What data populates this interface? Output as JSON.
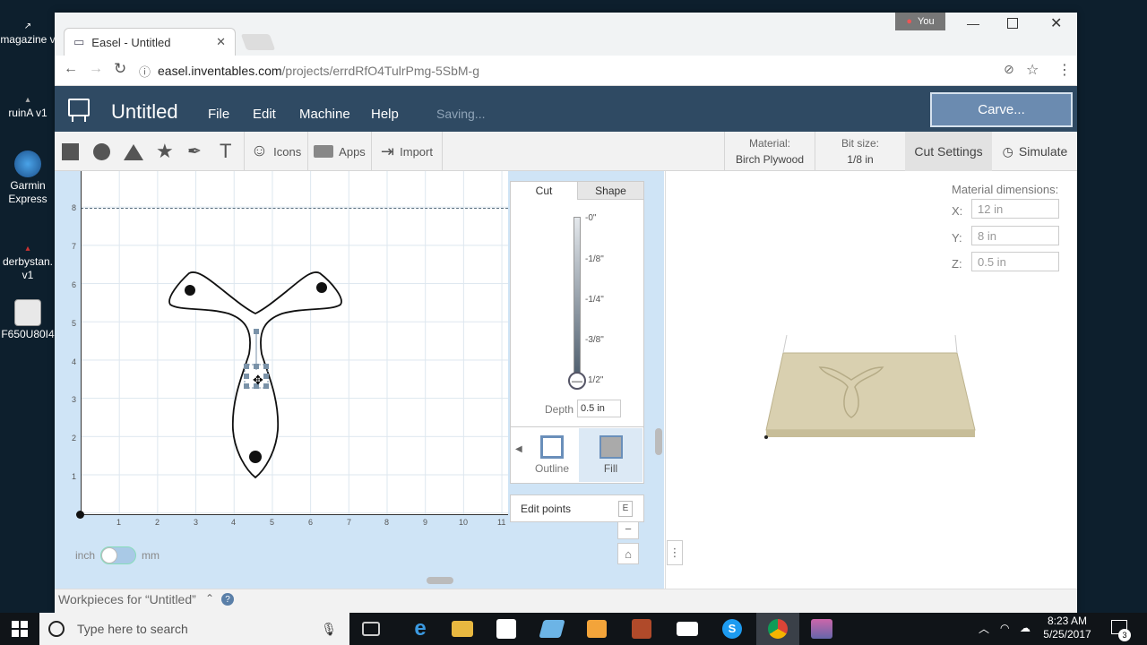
{
  "desktop": {
    "icons": [
      {
        "label": "magazine v"
      },
      {
        "label": "ruinA v1"
      },
      {
        "label": "Garmin Express"
      },
      {
        "label": "derbystan. v1"
      },
      {
        "label": "F650U80I4"
      }
    ],
    "user_badge": "You"
  },
  "browser": {
    "tab_title": "Easel - Untitled",
    "url_domain": "easel.inventables.com",
    "url_path": "/projects/errdRfO4TulrPmg-5SbM-g"
  },
  "app": {
    "title": "Untitled",
    "menus": [
      "File",
      "Edit",
      "Machine",
      "Help"
    ],
    "status": "Saving...",
    "carve_label": "Carve..."
  },
  "toolbar": {
    "icons_label": "Icons",
    "apps_label": "Apps",
    "import_label": "Import",
    "material_label": "Material:",
    "material_value": "Birch Plywood",
    "bit_label": "Bit size:",
    "bit_value": "1/8 in",
    "cut_settings_label": "Cut Settings",
    "simulate_label": "Simulate"
  },
  "canvas": {
    "x_ticks": [
      "1",
      "2",
      "3",
      "4",
      "5",
      "6",
      "7",
      "8",
      "9",
      "10",
      "11"
    ],
    "y_ticks": [
      "8",
      "7",
      "6",
      "5",
      "4",
      "3",
      "2",
      "1"
    ],
    "unit_left": "inch",
    "unit_right": "mm"
  },
  "cut_panel": {
    "tab_cut": "Cut",
    "tab_shape": "Shape",
    "depth_ticks": [
      "-0\"",
      "-1/8\"",
      "-1/4\"",
      "-3/8\"",
      "1/2\""
    ],
    "depth_label": "Depth",
    "depth_value": "0.5 in",
    "outline_label": "Outline",
    "fill_label": "Fill",
    "edit_points_label": "Edit points",
    "edit_points_key": "E"
  },
  "material_dimensions": {
    "title": "Material dimensions:",
    "x_label": "X:",
    "x_value": "12 in",
    "y_label": "Y:",
    "y_value": "8 in",
    "z_label": "Z:",
    "z_value": "0.5 in"
  },
  "workpieces": {
    "label": "Workpieces for “Untitled”"
  },
  "taskbar": {
    "search_placeholder": "Type here to search",
    "time": "8:23 AM",
    "date": "5/25/2017",
    "notification_count": "3"
  }
}
